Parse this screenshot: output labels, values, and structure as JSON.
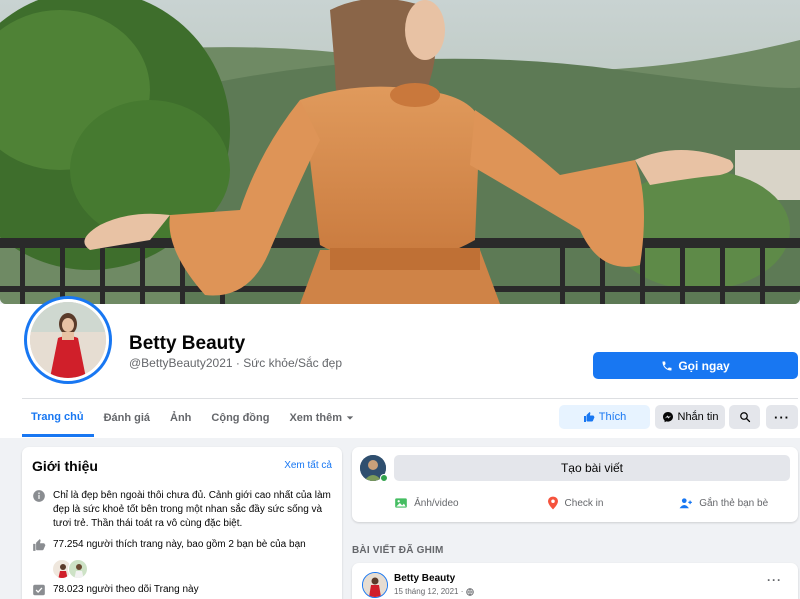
{
  "page": {
    "name": "Betty Beauty",
    "handle_category": "@BettyBeauty2021 · Sức khỏe/Sắc đẹp"
  },
  "actions": {
    "call_label": "Gọi ngay",
    "like_label": "Thích",
    "message_label": "Nhắn tin"
  },
  "tabs": [
    {
      "label": "Trang chủ",
      "active": true
    },
    {
      "label": "Đánh giá"
    },
    {
      "label": "Ảnh"
    },
    {
      "label": "Cộng đồng"
    },
    {
      "label": "Xem thêm"
    }
  ],
  "intro": {
    "title": "Giới thiệu",
    "see_all": "Xem tất cả",
    "bio": "Chỉ là đẹp bên ngoài thôi chưa đủ. Cảnh giới cao nhất của làm đẹp là sức khoẻ tốt bên trong một nhan sắc đầy sức sống và tươi trẻ. Thần thái toát ra vô cùng đặc biệt.",
    "likes": "77.254 người thích trang này, bao gồm 2 bạn bè của bạn",
    "followers": "78.023 người theo dõi Trang này"
  },
  "create_post": {
    "prompt": "Tạo bài viết",
    "photo_video": "Ảnh/video",
    "check_in": "Check in",
    "tag_friends": "Gắn thẻ bạn bè"
  },
  "pinned": {
    "label": "BÀI VIẾT ĐÃ GHIM",
    "author": "Betty Beauty",
    "date": "15 tháng 12, 2021 ·"
  },
  "colors": {
    "brand_blue": "#1877f2",
    "light_blue": "#e7f3ff",
    "gray_button": "#e4e6eb",
    "background": "#f0f2f5",
    "dress_orange": "#d98a4e",
    "red_dress": "#d01f2a"
  }
}
